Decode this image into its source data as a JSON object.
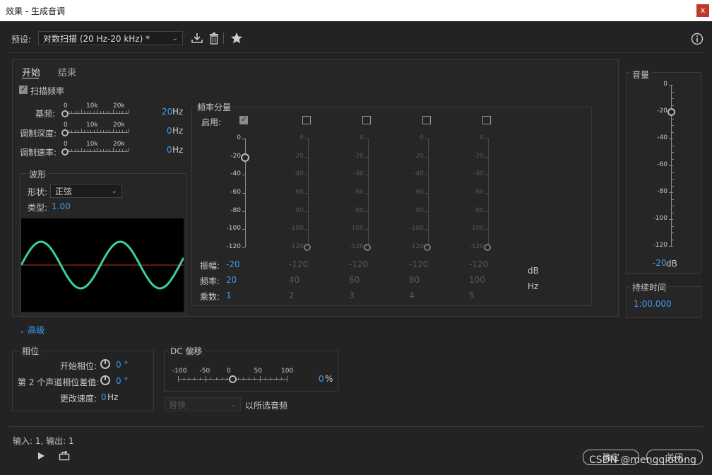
{
  "window": {
    "title": "效果 - 生成音调",
    "close": "x"
  },
  "preset": {
    "label": "预设:",
    "value": "对数扫描 (20 Hz-20 kHz) *"
  },
  "tabs": {
    "start": "开始",
    "end": "结束"
  },
  "sweep": {
    "label": "扫描频率",
    "checked": true
  },
  "params": {
    "scale": [
      "0",
      "10k",
      "20k"
    ],
    "base": {
      "label": "基频:",
      "value": "20",
      "unit": "Hz"
    },
    "mod_depth": {
      "label": "调制深度:",
      "value": "0",
      "unit": "Hz"
    },
    "mod_rate": {
      "label": "调制速率:",
      "value": "0",
      "unit": "Hz"
    }
  },
  "waveform": {
    "group": "波形",
    "shape_label": "形状:",
    "shape_value": "正弦",
    "type_label": "类型:",
    "type_value": "1.00"
  },
  "freq": {
    "group": "频率分量",
    "enable_label": "启用:",
    "scale": [
      "0",
      "-20",
      "-40",
      "-60",
      "-80",
      "-100",
      "-120"
    ],
    "amp_label": "振幅:",
    "freq_label": "频率:",
    "mult_label": "乘数:",
    "db_unit": "dB",
    "hz_unit": "Hz",
    "components": [
      {
        "enabled": true,
        "amp": "-20",
        "freq": "20",
        "mult": "1"
      },
      {
        "enabled": false,
        "amp": "-120",
        "freq": "40",
        "mult": "2"
      },
      {
        "enabled": false,
        "amp": "-120",
        "freq": "60",
        "mult": "3"
      },
      {
        "enabled": false,
        "amp": "-120",
        "freq": "80",
        "mult": "4"
      },
      {
        "enabled": false,
        "amp": "-120",
        "freq": "100",
        "mult": "5"
      }
    ]
  },
  "volume": {
    "label": "音量",
    "scale": [
      "0",
      "-20",
      "-40",
      "-60",
      "-80",
      "-100",
      "-120"
    ],
    "value": "-20",
    "unit": "dB"
  },
  "duration": {
    "label": "持续时间",
    "value": "1:00.000"
  },
  "advanced": {
    "label": "高级"
  },
  "phase": {
    "group": "相位",
    "start_label": "开始相位:",
    "start_value": "0 °",
    "diff_label": "第 2 个声道相位差值:",
    "diff_value": "0 °",
    "rate_label": "更改速度:",
    "rate_value": "0",
    "rate_unit": "Hz"
  },
  "dc": {
    "group": "DC 偏移",
    "scale": [
      "-100",
      "-50",
      "0",
      "50",
      "100"
    ],
    "value": "0",
    "unit": "%"
  },
  "replace": {
    "value": "替换",
    "suffix": "以所选音频"
  },
  "io": {
    "text": "输入: 1,  输出: 1"
  },
  "buttons": {
    "ok": "确定",
    "close": "关闭"
  },
  "watermark": "CSDN @mengqiutong",
  "colors": {
    "accent": "#3d9cf0",
    "wave": "#3fcf9a",
    "center_line": "#c0302a"
  }
}
